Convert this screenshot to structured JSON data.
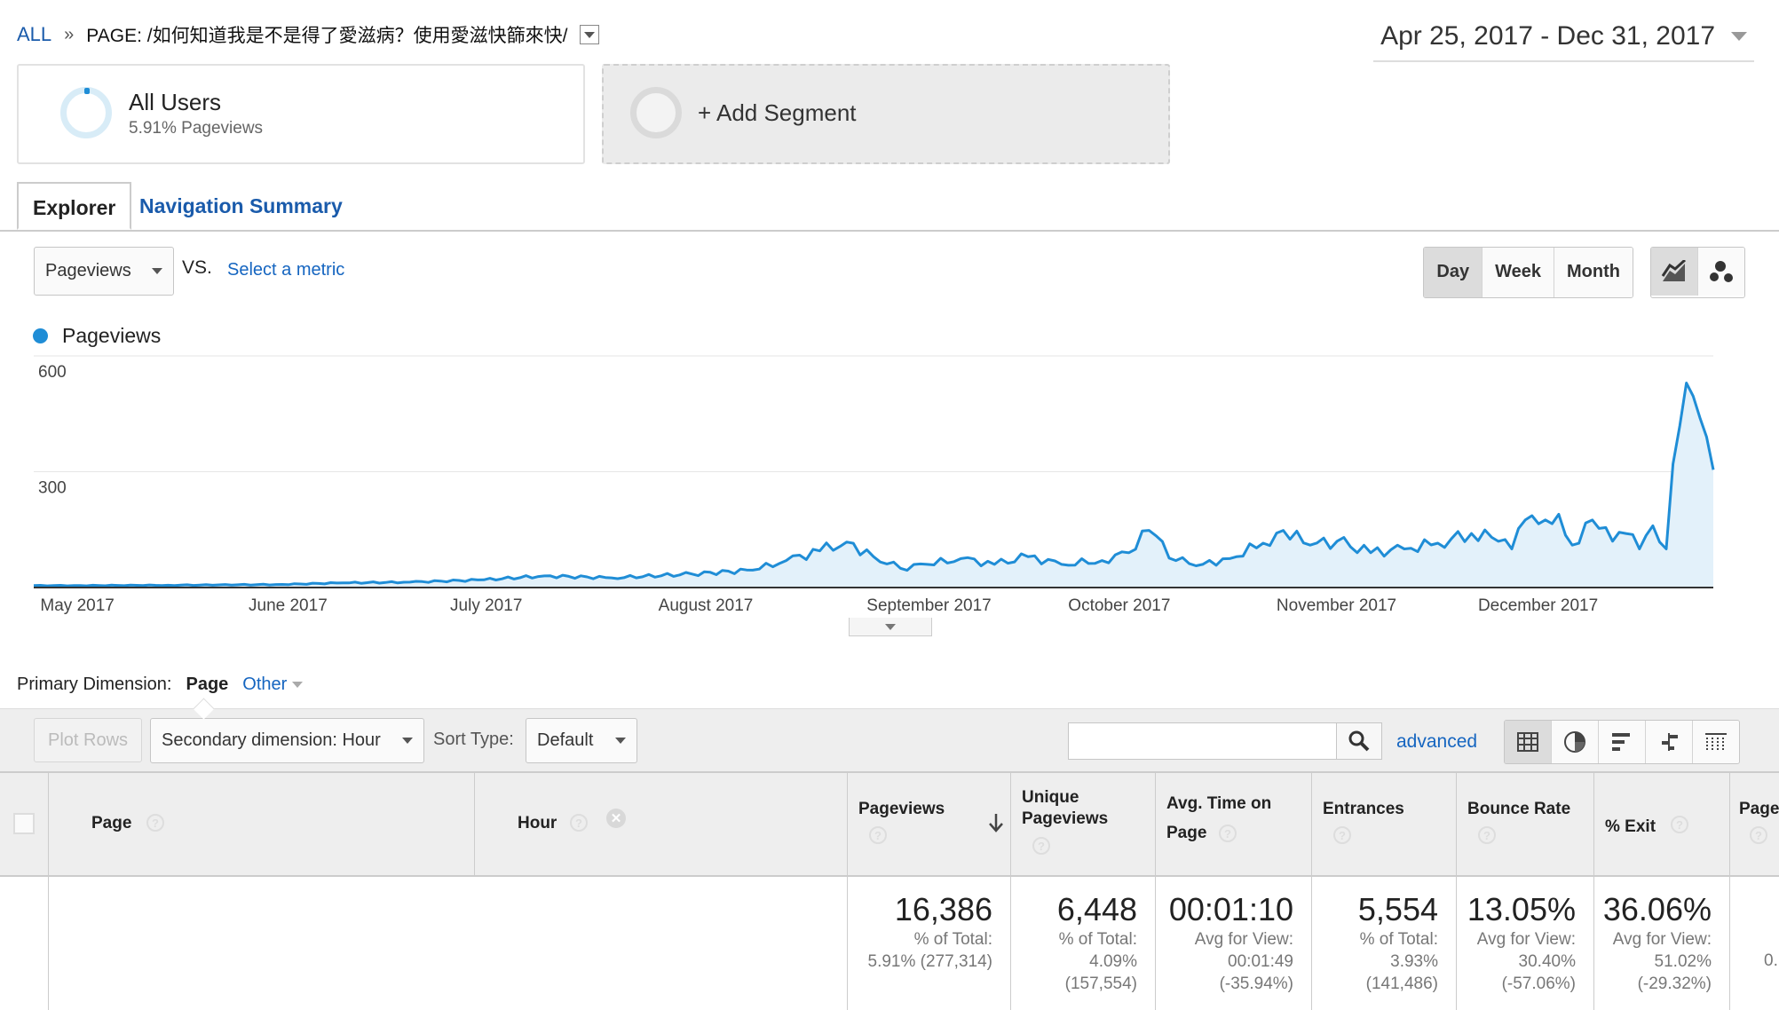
{
  "breadcrumb": {
    "all": "ALL",
    "separator": "»",
    "page": "PAGE: /如何知道我是不是得了愛滋病？使用愛滋快篩來快/"
  },
  "date_range": "Apr 25, 2017 - Dec 31, 2017",
  "segments": {
    "all_users": {
      "title": "All Users",
      "subtitle": "5.91% Pageviews"
    },
    "add_segment": "+ Add Segment"
  },
  "tabs": {
    "explorer": "Explorer",
    "navigation_summary": "Navigation Summary"
  },
  "metric_select": "Pageviews",
  "vs_label": "VS.",
  "select_metric": "Select a metric",
  "interval_buttons": [
    "Day",
    "Week",
    "Month"
  ],
  "chart_type_icons": [
    "line-chart-icon",
    "motion-chart-icon"
  ],
  "colors": {
    "series": "#1f8dd6",
    "area": "#e3f1fa",
    "link": "#1a5bab"
  },
  "chart_data": {
    "type": "area",
    "series": [
      {
        "name": "Pageviews"
      }
    ],
    "y_ticks": [
      "600",
      "300"
    ],
    "ylim": [
      0,
      600
    ],
    "x_tick_labels": [
      "May 2017",
      "June 2017",
      "July 2017",
      "August 2017",
      "September 2017",
      "October 2017",
      "November 2017",
      "December 2017"
    ],
    "x_range": [
      "2017-04-25",
      "2017-12-31"
    ],
    "grid": true,
    "legend": "top-left",
    "keypoints": [
      [
        "2017-04-25",
        5
      ],
      [
        "2017-05-01",
        5
      ],
      [
        "2017-05-15",
        6
      ],
      [
        "2017-06-01",
        8
      ],
      [
        "2017-06-10",
        12
      ],
      [
        "2017-06-20",
        14
      ],
      [
        "2017-07-01",
        20
      ],
      [
        "2017-07-10",
        30
      ],
      [
        "2017-07-20",
        25
      ],
      [
        "2017-08-01",
        35
      ],
      [
        "2017-08-10",
        45
      ],
      [
        "2017-08-15",
        70
      ],
      [
        "2017-08-20",
        95
      ],
      [
        "2017-08-24",
        118
      ],
      [
        "2017-08-28",
        80
      ],
      [
        "2017-09-01",
        50
      ],
      [
        "2017-09-05",
        60
      ],
      [
        "2017-09-10",
        75
      ],
      [
        "2017-09-15",
        60
      ],
      [
        "2017-09-20",
        80
      ],
      [
        "2017-09-25",
        60
      ],
      [
        "2017-10-01",
        70
      ],
      [
        "2017-10-05",
        90
      ],
      [
        "2017-10-08",
        148
      ],
      [
        "2017-10-12",
        70
      ],
      [
        "2017-10-16",
        60
      ],
      [
        "2017-10-20",
        75
      ],
      [
        "2017-10-25",
        115
      ],
      [
        "2017-10-28",
        148
      ],
      [
        "2017-11-01",
        110
      ],
      [
        "2017-11-05",
        120
      ],
      [
        "2017-11-10",
        90
      ],
      [
        "2017-11-15",
        100
      ],
      [
        "2017-11-20",
        115
      ],
      [
        "2017-11-25",
        140
      ],
      [
        "2017-11-28",
        130
      ],
      [
        "2017-12-01",
        100
      ],
      [
        "2017-12-03",
        175
      ],
      [
        "2017-12-05",
        165
      ],
      [
        "2017-12-08",
        190
      ],
      [
        "2017-12-10",
        110
      ],
      [
        "2017-12-13",
        175
      ],
      [
        "2017-12-16",
        120
      ],
      [
        "2017-12-18",
        140
      ],
      [
        "2017-12-20",
        100
      ],
      [
        "2017-12-22",
        160
      ],
      [
        "2017-12-24",
        100
      ],
      [
        "2017-12-25",
        320
      ],
      [
        "2017-12-27",
        530
      ],
      [
        "2017-12-29",
        440
      ],
      [
        "2017-12-31",
        305
      ]
    ]
  },
  "primary_dimension": {
    "label": "Primary Dimension:",
    "value": "Page",
    "other": "Other"
  },
  "toolbar": {
    "plot_rows": "Plot Rows",
    "secondary_dimension": "Secondary dimension: Hour",
    "sort_type_label": "Sort Type:",
    "sort_type": "Default",
    "search_value": "",
    "advanced": "advanced",
    "view_icons": [
      "table-view-icon",
      "pie-view-icon",
      "bar-view-icon",
      "comparison-view-icon",
      "pivot-view-icon"
    ]
  },
  "table": {
    "headers": {
      "page": "Page",
      "hour": "Hour",
      "pageviews": "Pageviews",
      "unique_pageviews": "Unique Pageviews",
      "avg_time_on_page": "Avg. Time on Page",
      "entrances": "Entrances",
      "bounce_rate": "Bounce Rate",
      "exit": "% Exit",
      "page_value": "Page"
    },
    "totals": {
      "pageviews": {
        "value": "16,386",
        "l1": "% of Total:",
        "l2": "5.91% (277,314)",
        "l3": ""
      },
      "unique_pageviews": {
        "value": "6,448",
        "l1": "% of Total:",
        "l2": "4.09%",
        "l3": "(157,554)"
      },
      "avg_time_on_page": {
        "value": "00:01:10",
        "l1": "Avg for View:",
        "l2": "00:01:49",
        "l3": "(-35.94%)"
      },
      "entrances": {
        "value": "5,554",
        "l1": "% of Total:",
        "l2": "3.93%",
        "l3": "(141,486)"
      },
      "bounce_rate": {
        "value": "13.05%",
        "l1": "Avg for View:",
        "l2": "30.40%",
        "l3": "(-57.06%)"
      },
      "exit": {
        "value": "36.06%",
        "l1": "Avg for View:",
        "l2": "51.02%",
        "l3": "(-29.32%)"
      },
      "page_value": {
        "value": "",
        "l1": "",
        "l2": "0.",
        "l3": ""
      }
    }
  }
}
